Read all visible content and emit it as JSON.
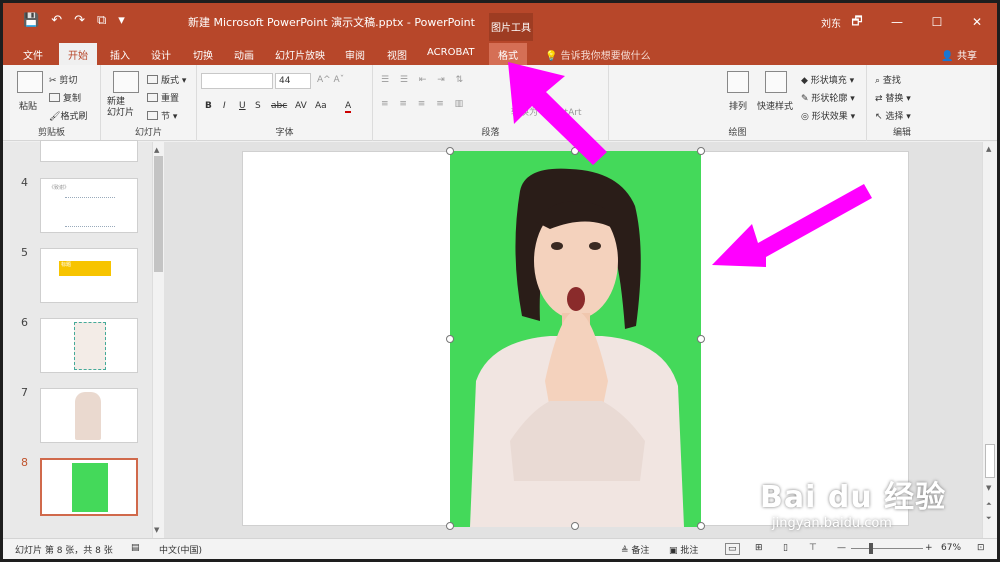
{
  "window": {
    "title": "新建 Microsoft PowerPoint 演示文稿.pptx  -  PowerPoint",
    "context_tool": "图片工具",
    "user": "刘东",
    "qat": [
      "💾",
      "↶",
      "↷",
      "⧉",
      "▾"
    ],
    "controls": [
      "🗗",
      "—",
      "☐",
      "✕"
    ]
  },
  "tabs": [
    "文件",
    "开始",
    "插入",
    "设计",
    "切换",
    "动画",
    "幻灯片放映",
    "审阅",
    "视图",
    "ACROBAT",
    "格式"
  ],
  "tell_me": "告诉我你想要做什么",
  "share": "共享",
  "ribbon": {
    "clipboard": {
      "paste": "粘贴",
      "cut": "剪切",
      "copy": "复制",
      "painter": "格式刷",
      "label": "剪贴板"
    },
    "slides": {
      "new": "新建\n幻灯片",
      "layout": "版式",
      "reset": "重置",
      "section": "节",
      "label": "幻灯片"
    },
    "font": {
      "size": "44",
      "label": "字体",
      "buttons": [
        "B",
        "I",
        "U",
        "S",
        "abc",
        "AV",
        "Aa",
        "A"
      ]
    },
    "paragraph": {
      "label": "段落",
      "convert": "转换为 SmartArt"
    },
    "drawing": {
      "arrange": "排列",
      "quick_styles": "快速样式",
      "fill": "形状填充",
      "outline": "形状轮廓",
      "effects": "形状效果",
      "label": "绘图"
    },
    "editing": {
      "find": "查找",
      "replace": "替换",
      "select": "选择",
      "label": "编辑"
    }
  },
  "thumbnails": [
    {
      "num": "4",
      "text": "《致谢》"
    },
    {
      "num": "5",
      "text": "标题"
    },
    {
      "num": "6",
      "text": ""
    },
    {
      "num": "7",
      "text": ""
    },
    {
      "num": "8",
      "text": ""
    }
  ],
  "status": {
    "slide_info": "幻灯片 第 8 张，共 8 张",
    "language": "中文(中国)",
    "notes": "备注",
    "comments": "批注",
    "zoom": "67%"
  },
  "watermark": {
    "brand": "Bai du 经验",
    "url": "jingyan.baidu.com"
  },
  "colors": {
    "accent": "#b7472a",
    "picture_bg": "#44d95a",
    "arrow": "#ff00ff"
  }
}
